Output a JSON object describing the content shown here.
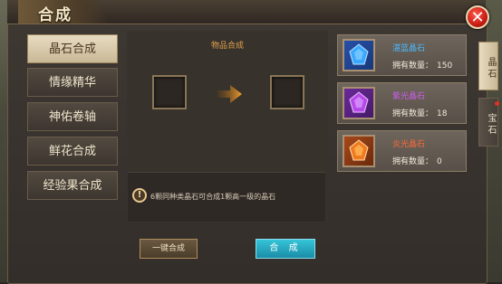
{
  "window": {
    "title": "合成"
  },
  "nav": {
    "items": [
      {
        "label": "晶石合成",
        "active": true
      },
      {
        "label": "情缘精华",
        "active": false
      },
      {
        "label": "神佑卷轴",
        "active": false
      },
      {
        "label": "鲜花合成",
        "active": false
      },
      {
        "label": "经验果合成",
        "active": false
      }
    ]
  },
  "center": {
    "title": "物品合成",
    "info": "6颗同种类晶石可合成1颗高一级的晶石",
    "oneclick_label": "一键合成",
    "compose_label": "合 成"
  },
  "gems": [
    {
      "name": "湛蓝晶石",
      "count_label": "拥有数量：",
      "count": "150",
      "color": "#3aa8ff",
      "name_color": "#4ab8ff",
      "icon": "blue-gem-icon"
    },
    {
      "name": "紫光晶石",
      "count_label": "拥有数量：",
      "count": "18",
      "color": "#b64ae8",
      "name_color": "#d05cf0",
      "icon": "purple-gem-icon"
    },
    {
      "name": "炎光晶石",
      "count_label": "拥有数量：",
      "count": "0",
      "color": "#f07a20",
      "name_color": "#ff6a3a",
      "icon": "orange-gem-icon"
    }
  ],
  "side_tabs": [
    {
      "label": "晶石",
      "active": true
    },
    {
      "label": "宝石",
      "active": false
    }
  ],
  "colors": {
    "accent_title": "#e0a24a",
    "compose_button": "#26a8c0",
    "close_button": "#c81c14"
  }
}
